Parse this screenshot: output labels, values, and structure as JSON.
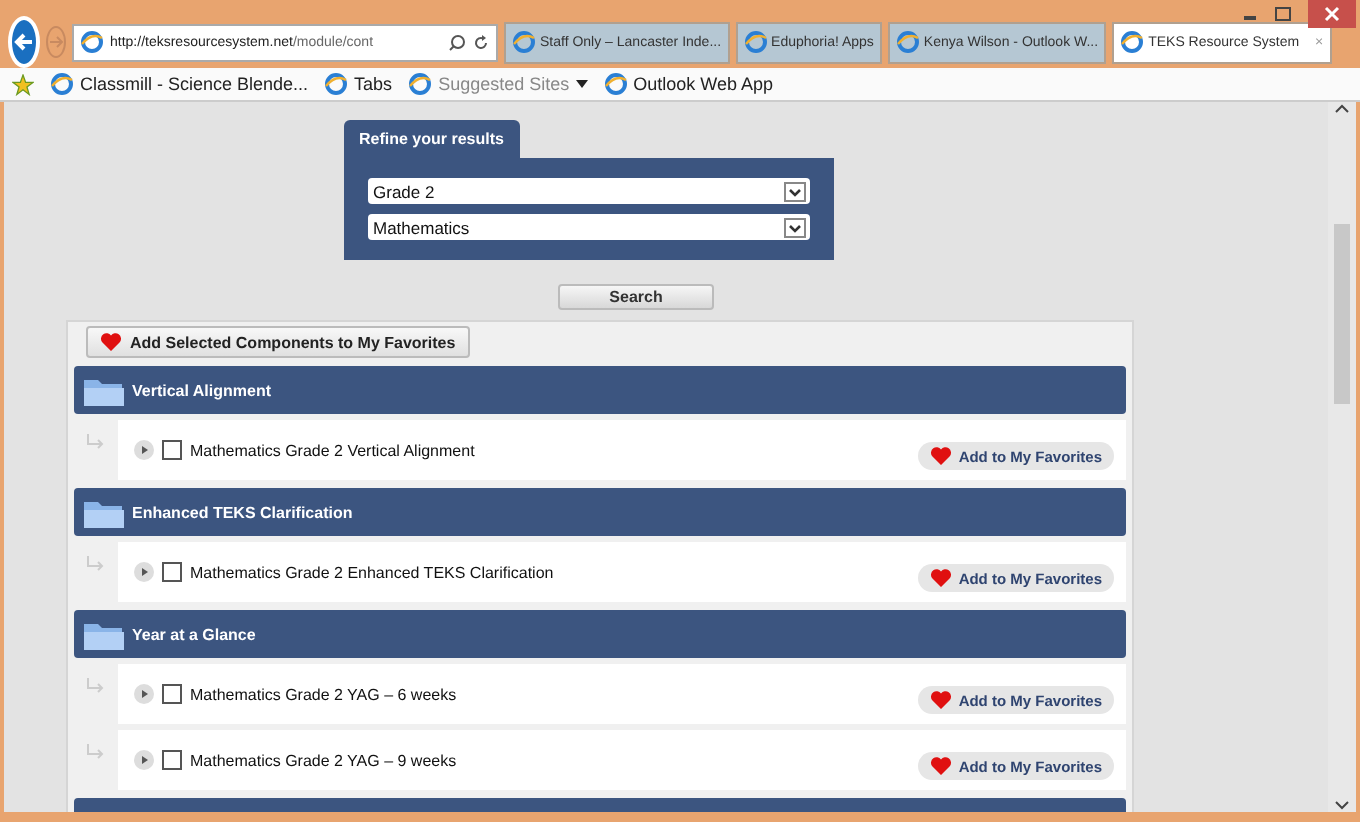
{
  "browser": {
    "url_host": "http://teksresourcesystem.net",
    "url_path": "/module/cont",
    "tabs": [
      {
        "label": "Staff Only – Lancaster Inde...",
        "selected": false
      },
      {
        "label": "Eduphoria! Apps",
        "selected": false
      },
      {
        "label": "Kenya Wilson - Outlook W...",
        "selected": false
      },
      {
        "label": "TEKS Resource System",
        "selected": true,
        "close": "×"
      }
    ],
    "favorites": [
      {
        "label": "Classmill - Science Blende...",
        "dimmed": false
      },
      {
        "label": "Tabs",
        "dimmed": false
      },
      {
        "label": "Suggested Sites",
        "dimmed": true,
        "dropdown": true
      },
      {
        "label": "Outlook Web App",
        "dimmed": false
      }
    ]
  },
  "refine": {
    "title": "Refine your results",
    "selects": [
      {
        "value": "Grade 2"
      },
      {
        "value": "Mathematics"
      }
    ],
    "search_button": "Search"
  },
  "results": {
    "add_selected_button": "Add Selected Components to My Favorites",
    "sections": [
      {
        "title": "Vertical Alignment",
        "items": [
          {
            "label": "Mathematics Grade 2 Vertical Alignment",
            "checked": false,
            "button": "Add to My Favorites"
          }
        ]
      },
      {
        "title": "Enhanced TEKS Clarification",
        "items": [
          {
            "label": "Mathematics Grade 2 Enhanced TEKS Clarification",
            "checked": false,
            "button": "Add to My Favorites"
          }
        ]
      },
      {
        "title": "Year at a Glance",
        "items": [
          {
            "label": "Mathematics Grade 2 YAG – 6 weeks",
            "checked": false,
            "button": "Add to My Favorites"
          },
          {
            "label": "Mathematics Grade 2 YAG – 9 weeks",
            "checked": false,
            "button": "Add to My Favorites"
          }
        ]
      }
    ]
  }
}
